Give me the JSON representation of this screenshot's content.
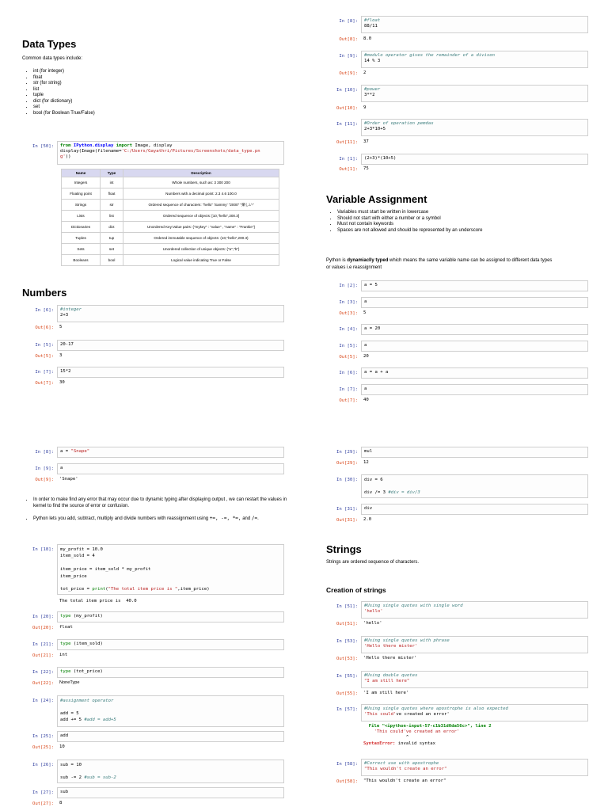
{
  "data_types": {
    "title": "Data Types",
    "intro": "Common data types include:",
    "bullets": [
      "int (for integer)",
      "float",
      "str (for string)",
      "list",
      "tuple",
      "dict (for dictionary)",
      "set",
      "bool (for Boolean True/False)"
    ],
    "cell50": {
      "prompt": "In [50]:",
      "line1_kw1": "from",
      "line1_mod": "IPython.display",
      "line1_kw2": "import",
      "line1_rest": "Image, display",
      "line2_a": "display(Image(filename=",
      "line2_str": "'C:/Users/Gayathri/Pictures/Screenshots/data_type.pn",
      "line3_str": "g'",
      "line3_b": "))"
    },
    "table": {
      "headers": [
        "Name",
        "Type",
        "Description"
      ],
      "rows": [
        [
          "Integers",
          "int",
          "Whole numbers, such as:  3   300   200"
        ],
        [
          "Floating point",
          "float",
          "Numbers with a decimal point:  2.3   4.6   100.0"
        ],
        [
          "Strings",
          "str",
          "Ordered sequence of characters:  \"hello\"  'Sammy'  \"2000\"  \"楽しい\""
        ],
        [
          "Lists",
          "list",
          "Ordered sequence of objects:  [10,\"hello\",200.3]"
        ],
        [
          "Dictionaries",
          "dict",
          "Unordered Key:Value pairs:  {\"mykey\" : \"value\" , \"name\" : \"Frankie\"}"
        ],
        [
          "Tuples",
          "tup",
          "Ordered immutable sequence of objects:  (10,\"hello\",200.3)"
        ],
        [
          "Sets",
          "set",
          "Unordered collection of unique objects:  {\"a\",\"b\"}"
        ],
        [
          "Booleans",
          "bool",
          "Logical value indicating True or False"
        ]
      ]
    }
  },
  "numbers": {
    "title": "Numbers",
    "cells": [
      {
        "in": "In [6]:",
        "comment": "#integer",
        "code": "2+3",
        "out": "Out[6]:",
        "result": "5"
      },
      {
        "in": "In [5]:",
        "code": "20-17",
        "out": "Out[5]:",
        "result": "3"
      },
      {
        "in": "In [7]:",
        "code": "15*2",
        "out": "Out[7]:",
        "result": "30"
      }
    ]
  },
  "right_top": {
    "cells": [
      {
        "in": "In [8]:",
        "comment": "#float",
        "code": "88/11",
        "out": "Out[8]:",
        "result": "8.0"
      },
      {
        "in": "In [9]:",
        "comment": "#modulo operator gives the remainder of a divison",
        "code": "14 % 3",
        "out": "Out[9]:",
        "result": "2"
      },
      {
        "in": "In [10]:",
        "comment": "#power",
        "code": "3**2",
        "out": "Out[10]:",
        "result": "9"
      },
      {
        "in": "In [11]:",
        "comment": "#Order of operation pemdas",
        "code": "2+3*10+5",
        "out": "Out[11]:",
        "result": "37"
      },
      {
        "in": "In [1]:",
        "code": "(2+3)*(10+5)",
        "out": "Out[1]:",
        "result": "75"
      }
    ]
  },
  "variable_assignment": {
    "title": "Variable Assignment",
    "bullets": [
      "Variables must start be written in lowercase",
      "Should not start with either a number or a symbol",
      "Must not contain keywords",
      "Spaces are not allowed and should be represented by an underscore"
    ],
    "para_a": "Python is ",
    "para_bold": "dynamiaclly typed",
    "para_b": " which means the same variable name can be assigned to different data types",
    "para_line2": "or values i.e reassignment",
    "cells": [
      {
        "in": "In [2]:",
        "code": "a = 5"
      },
      {
        "in": "In [3]:",
        "code": "a",
        "out": "Out[3]:",
        "result": "5"
      },
      {
        "in": "In [4]:",
        "code": "a = 20"
      },
      {
        "in": "In [5]:",
        "code": "a",
        "out": "Out[5]:",
        "result": "20"
      },
      {
        "in": "In [6]:",
        "code": "a = a + a"
      },
      {
        "in": "In [7]:",
        "code": "a",
        "out": "Out[7]:",
        "result": "40"
      }
    ]
  },
  "left_bottom": {
    "cell8": {
      "in": "In [8]:",
      "code_a": "a = ",
      "code_str": "\"Snape\""
    },
    "cell9": {
      "in": "In [9]:",
      "code": "a",
      "out": "Out[9]:",
      "result": "'Snape'"
    },
    "bullet1": "In order to make find any error that may occur due to dynamic typing after displaying output , we can restart the values in kernel to find the source of error or confusion.",
    "bullet2_a": "Python lets you add, subtract, multiply and divide numbers with reassignment using ",
    "bullet2_ops": "+=, -=, *=,",
    "bullet2_b": " and ",
    "bullet2_ops2": "/=",
    "bullet2_end": ".",
    "cell18": {
      "in": "In [18]:",
      "l1": "my_profit = 10.0",
      "l2": "item_sold = 4",
      "l3": "item_price = item_sold * my_profit",
      "l4": "item_price",
      "l5_a": "tot_price = ",
      "l5_fn": "print",
      "l5_b": "(",
      "l5_str": "\"The total item price is \"",
      "l5_c": ",item_price)",
      "output": "The total item price is  40.0"
    },
    "cell20": {
      "in": "In [20]:",
      "fn": "type",
      "arg": " (my_profit)",
      "out": "Out[20]:",
      "result": "float"
    },
    "cell21": {
      "in": "In [21]:",
      "fn": "type",
      "arg": " (item_sold)",
      "out": "Out[21]:",
      "result": "int"
    },
    "cell22": {
      "in": "In [22]:",
      "fn": "type",
      "arg": " (tot_price)",
      "out": "Out[22]:",
      "result": "NoneType"
    },
    "cell24": {
      "in": "In [24]:",
      "comment": "#assignment operator",
      "l1": "add = 5",
      "l2_a": "add += 5 ",
      "l2_c": "#add = add+5"
    },
    "cell25": {
      "in": "In [25]:",
      "code": "add",
      "out": "Out[25]:",
      "result": "10"
    },
    "cell26": {
      "in": "In [26]:",
      "l1": "sub = 10",
      "l2_a": "sub -= 2 ",
      "l2_c": "#sub = sub-2"
    },
    "cell27": {
      "in": "In [27]:",
      "code": "sub",
      "out": "Out[27]:",
      "result": "8"
    }
  },
  "right_bottom": {
    "cell29": {
      "in": "In [29]:",
      "code": "mul",
      "out": "Out[29]:",
      "result": "12"
    },
    "cell30": {
      "in": "In [30]:",
      "l1": "div = 6",
      "l2_a": "div /= 3 ",
      "l2_c": "#div = div/3"
    },
    "cell31": {
      "in": "In [31]:",
      "code": "div",
      "out": "Out[31]:",
      "result": "2.0"
    },
    "strings_title": "Strings",
    "strings_intro": "Strings are ordered sequence of characters.",
    "creation_title": "Creation of strings",
    "cell51": {
      "in": "In [51]:",
      "comment": "#Using single quotes with single word",
      "str": "'hello'",
      "out": "Out[51]:",
      "result": "'hello'"
    },
    "cell53": {
      "in": "In [53]:",
      "comment": "#Using single quotes with phrase",
      "str": "'Hello there mister'",
      "out": "Out[53]:",
      "result": "'Hello there mister'"
    },
    "cell55": {
      "in": "In [55]:",
      "comment": "#Using double quotes",
      "str": "\"I am still here\"",
      "out": "Out[55]:",
      "result": "'I am still here'"
    },
    "cell57": {
      "in": "In [57]:",
      "comment": "#Using single quotes where apostrophe is also expected",
      "code_a": "'This could'",
      "code_b": "ve created an error'",
      "err1": "  File \"<ipython-input-57-c1b31d0da56c>\", line 2",
      "err2": "    'This could've created an error'",
      "err3": "                ^",
      "err4_a": "SyntaxError:",
      "err4_b": " invalid syntax"
    },
    "cell58": {
      "in": "In [58]:",
      "comment": "#Correct use with apostrophe",
      "str": "\"This wouldn't create an error\"",
      "out": "Out[58]:",
      "result": "\"This wouldn't create an error\""
    }
  }
}
